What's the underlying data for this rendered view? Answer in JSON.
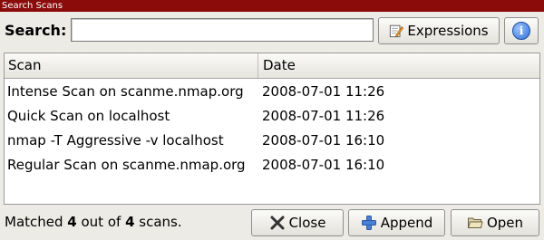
{
  "window": {
    "title": "Search Scans"
  },
  "search": {
    "label": "Search:",
    "value": "",
    "placeholder": ""
  },
  "toolbar": {
    "expressions_label": "Expressions",
    "info_icon": "info-icon"
  },
  "table": {
    "columns": [
      "Scan",
      "Date"
    ],
    "rows": [
      {
        "scan": "Intense Scan on scanme.nmap.org",
        "date": "2008-07-01 11:26"
      },
      {
        "scan": "Quick Scan on localhost",
        "date": "2008-07-01 11:26"
      },
      {
        "scan": "nmap -T Aggressive -v localhost",
        "date": "2008-07-01 16:10"
      },
      {
        "scan": "Regular Scan on scanme.nmap.org",
        "date": "2008-07-01 16:10"
      }
    ]
  },
  "footer": {
    "matched_prefix": "Matched ",
    "matched_count": "4",
    "matched_middle": " out of ",
    "total_count": "4",
    "matched_suffix": " scans."
  },
  "buttons": {
    "close": "Close",
    "append": "Append",
    "open": "Open"
  },
  "colors": {
    "titlebar": "#8b0b0b",
    "window_bg": "#ecebe6"
  }
}
